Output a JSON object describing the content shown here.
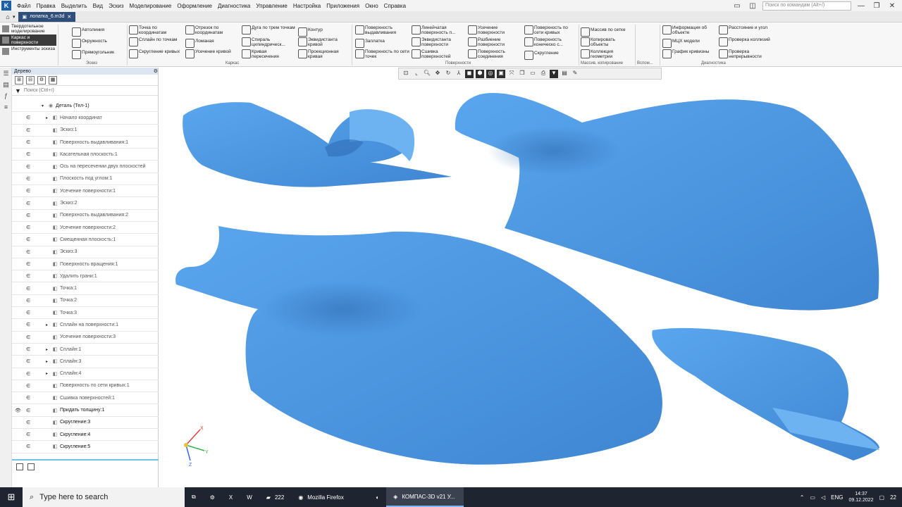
{
  "menu": {
    "items": [
      "Файл",
      "Правка",
      "Выделить",
      "Вид",
      "Эскиз",
      "Моделирование",
      "Оформление",
      "Диагностика",
      "Управление",
      "Настройка",
      "Приложения",
      "Окно",
      "Справка"
    ],
    "search_placeholder": "Поиск по командам (Alt+/)"
  },
  "tab": {
    "label": "лопатка_6.m3d"
  },
  "ribbon": {
    "modes": [
      "Твердотельное моделирование",
      "Каркас и поверхности",
      "Инструменты эскиза"
    ],
    "sketch": [
      "Автолиния",
      "Окружность",
      "Прямоугольник"
    ],
    "wire1": [
      "Точка по координатам",
      "Сплайн по точкам",
      "Скругление кривых"
    ],
    "wire2": [
      "Отрезок по координатам",
      "Ломаная",
      "Усечение кривой"
    ],
    "wire3": [
      "Дуга по трем точкам",
      "Спираль цилиндрическ...",
      "Кривая пересечения"
    ],
    "wire4": [
      "Контур",
      "Эквидистанта кривой",
      "Проекционная кривая"
    ],
    "surf1": [
      "Поверхность выдавливания",
      "Заплатка",
      "Поверхность по сети точек"
    ],
    "surf2": [
      "Линейчатая поверхность п...",
      "Эквидистанта поверхности",
      "Сшивка поверхностей"
    ],
    "surf3": [
      "Усечение поверхности",
      "Разбиение поверхности",
      "Поверхность соединения"
    ],
    "surf4": [
      "Поверхность по сети кривых",
      "Поверхность коническо с...",
      "Скругление"
    ],
    "arr": [
      "Массив по сетке",
      "Копировать объекты",
      "Коллекция геометрии"
    ],
    "diag1": [
      "Информация об объекте",
      "МЦХ модели",
      "График кривизны"
    ],
    "diag2": [
      "Расстояние и угол",
      "Проверка коллизий",
      "Проверка непрерывности"
    ],
    "groups": {
      "sketch": "Эскиз",
      "wire": "Каркас",
      "surf": "Поверхности",
      "arr": "Массив, копирование",
      "aux": "Вспом...",
      "diag": "Диагностика"
    }
  },
  "tree": {
    "title": "Дерево",
    "filter_placeholder": "Поиск (Ctrl+/)",
    "root": "Деталь (Тел-1)",
    "items": [
      "Начало координат",
      "Эскиз:1",
      "Поверхность выдавливания:1",
      "Касательная плоскость:1",
      "Ось на пересечении двух плоскостей",
      "Плоскость под углом:1",
      "Усечение поверхности:1",
      "Эскиз:2",
      "Поверхность выдавливания:2",
      "Усечение поверхности:2",
      "Смещенная плоскость:1",
      "Эскиз:3",
      "Поверхность вращения:1",
      "Удалить грани:1",
      "Точка:1",
      "Точка:2",
      "Точка:3",
      "Сплайн на поверхности:1",
      "Усечение поверхности:3",
      "Сплайн:1",
      "Сплайн:3",
      "Сплайн:4",
      "Поверхность по сети кривых:1",
      "Сшивка поверхностей:1",
      "Придать толщину:1",
      "Скругление:3",
      "Скругление:4",
      "Скругление:5"
    ]
  },
  "axes": {
    "x": "X",
    "y": "Y",
    "z": "Z"
  },
  "taskbar": {
    "search": "Type here to search",
    "apps": [
      "222",
      "Mozilla Firefox",
      "КОМПАС-3D v21 У..."
    ],
    "lang": "ENG",
    "time": "14:37",
    "date": "09.12.2022",
    "notif": "22"
  },
  "colors": {
    "model": "#4d9ae6",
    "model_dark": "#3a7fc7",
    "accent": "#6fc2e8"
  }
}
